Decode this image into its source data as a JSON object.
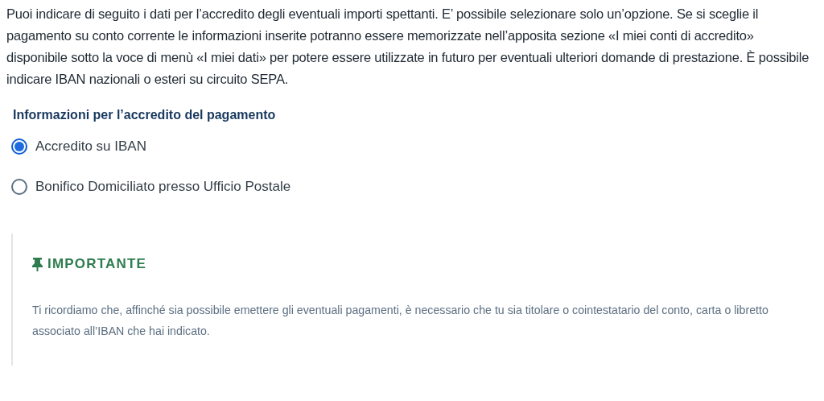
{
  "intro": "Puoi indicare di seguito i dati per l’accredito degli eventuali importi spettanti. E’ possibile selezionare solo un’opzione. Se si sceglie il pagamento su conto corrente le informazioni inserite potranno essere memorizzate nell’apposita sezione «I miei conti di accredito» disponibile sotto la voce di menù «I miei dati» per potere essere utilizzate in futuro per eventuali ulteriori domande di prestazione. È possibile indicare IBAN nazionali o esteri su circuito SEPA.",
  "section": {
    "title": "Informazioni per l’accredito del pagamento",
    "options": [
      {
        "label": "Accredito su IBAN",
        "selected": true
      },
      {
        "label": "Bonifico Domiciliato presso Ufficio Postale",
        "selected": false
      }
    ]
  },
  "callout": {
    "title": "IMPORTANTE",
    "text": "Ti ricordiamo che, affinché sia possibile emettere gli eventuali pagamenti, è necessario che tu sia titolare o cointestatario del conto, carta o libretto associato all’IBAN che hai indicato."
  }
}
